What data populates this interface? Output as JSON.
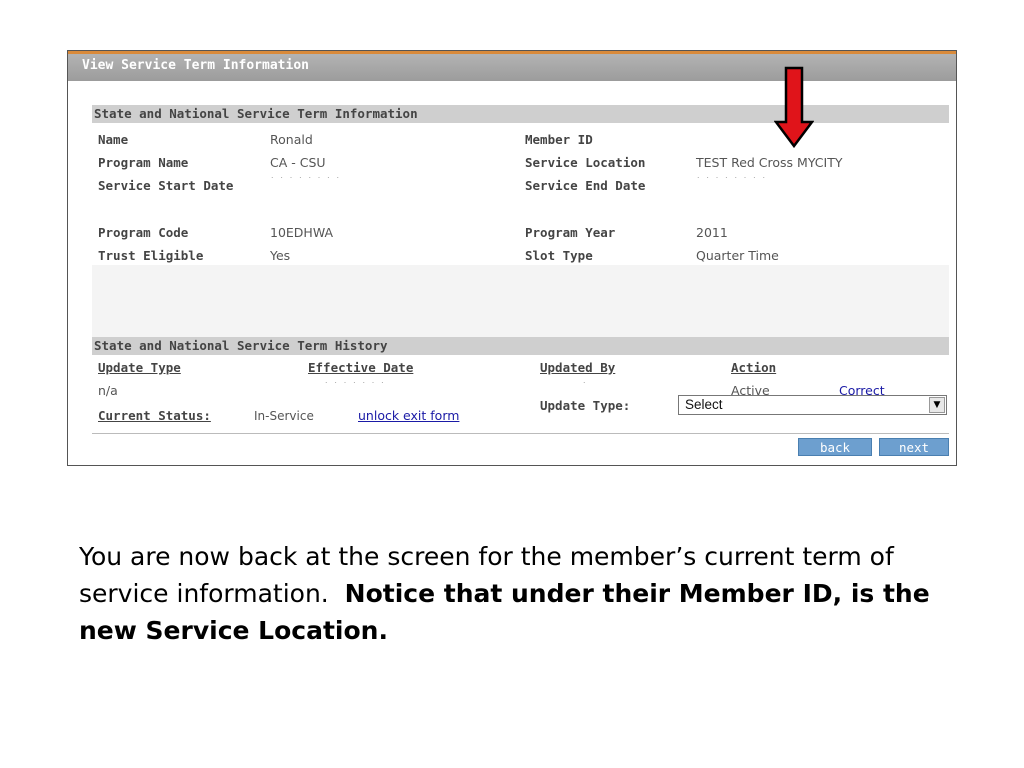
{
  "window": {
    "title": "View Service Term Information"
  },
  "info_section": {
    "heading": "State and National Service Term Information",
    "rows": [
      {
        "label": "Name",
        "value": "Ronald",
        "label2": "Member ID",
        "value2": ""
      },
      {
        "label": "Program Name",
        "value": "CA - CSU",
        "label2": "Service Location",
        "value2": "TEST Red Cross MYCITY"
      },
      {
        "label": "Service Start Date",
        "value": "",
        "label2": "Service End Date",
        "value2": ""
      },
      {
        "label": "Program Code",
        "value": "10EDHWA",
        "label2": "Program Year",
        "value2": "2011"
      },
      {
        "label": "Trust Eligible",
        "value": "Yes",
        "label2": "Slot Type",
        "value2": "Quarter Time"
      }
    ]
  },
  "history_section": {
    "heading": "State and National Service Term History",
    "columns": [
      "Update Type",
      "Effective Date",
      "Updated By",
      "Action"
    ],
    "row": {
      "update_type": "n/a",
      "effective_date": "",
      "updated_by": "",
      "action": "Active",
      "link": "Correct"
    },
    "current_status_label": "Current Status:",
    "current_status_value": "In-Service",
    "unlock_link": "unlock exit form"
  },
  "update_type": {
    "label": "Update Type:",
    "selected": "Select"
  },
  "buttons": {
    "back": "back",
    "next": "next"
  },
  "annotation": {
    "arrow_color": "#e0141a"
  },
  "caption": {
    "normal": "You are now back at the screen for the member’s current term of service information.",
    "bold": "Notice that under their Member ID, is the new Service Location."
  }
}
